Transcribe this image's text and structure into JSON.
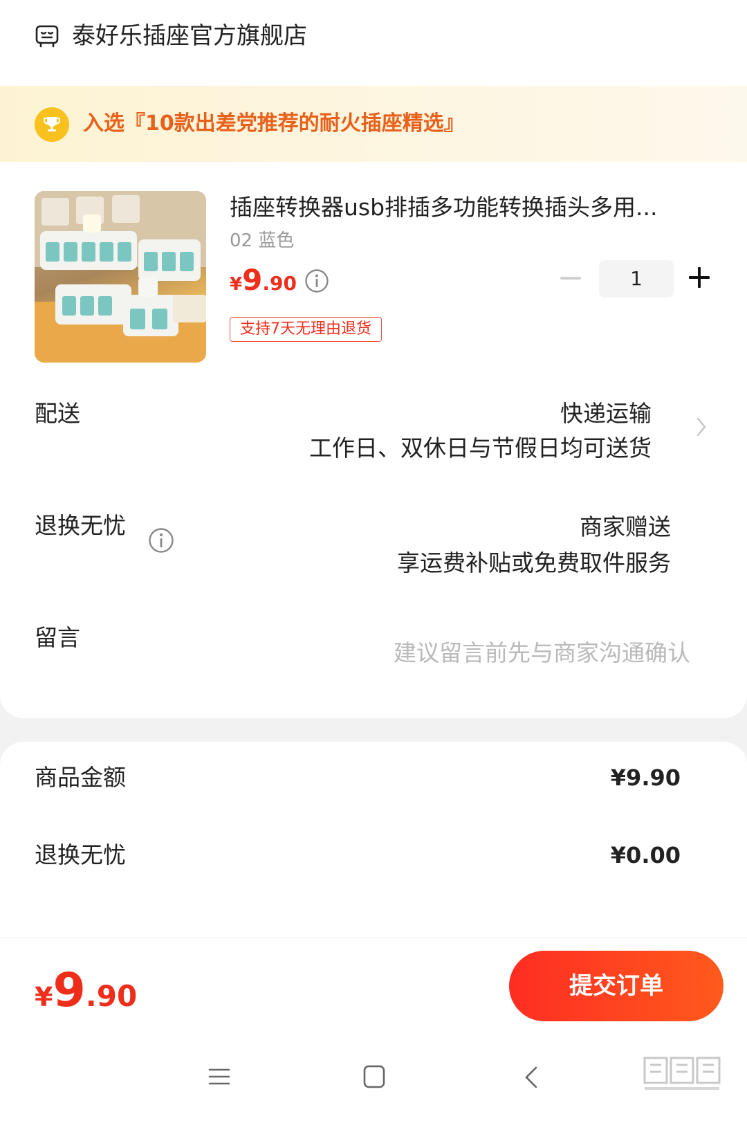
{
  "store": {
    "name": "泰好乐插座官方旗舰店",
    "icon": "store-icon"
  },
  "banner": {
    "text": "入选『10款出差党推荐的耐火插座精选』",
    "icon": "trophy-icon"
  },
  "product": {
    "title": "插座转换器usb排插多功能转换插头多用...",
    "variant": "02 蓝色",
    "price_symbol": "¥",
    "price_int": "9",
    "price_dec": ".90",
    "quantity": "1",
    "tag": "支持7天无理由退货"
  },
  "delivery": {
    "label": "配送",
    "method": "快递运输",
    "note": "工作日、双休日与节假日均可送货"
  },
  "return_service": {
    "label": "退换无忧",
    "value": "商家赠送",
    "note": "享运费补贴或免费取件服务"
  },
  "message": {
    "label": "留言",
    "placeholder": "建议留言前先与商家沟通确认"
  },
  "summary": {
    "goods_label": "商品金额",
    "goods_value": "¥9.90",
    "return_label": "退换无忧",
    "return_value": "¥0.00"
  },
  "footer": {
    "price_symbol": "¥",
    "price_int": "9",
    "price_dec": ".90",
    "submit_label": "提交订单"
  },
  "colors": {
    "accent": "#ee2e1b",
    "banner_text": "#e8601a",
    "trophy": "#f8c11e"
  }
}
